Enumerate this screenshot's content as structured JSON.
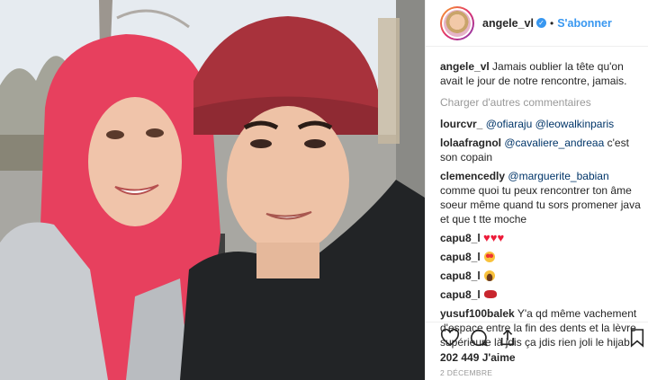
{
  "post": {
    "username": "angele_vl",
    "follow_label": "S'abonner",
    "separator": "•",
    "caption": "Jamais oublier la tête qu'on avait le jour de notre rencontre, jamais.",
    "load_more": "Charger d'autres commentaires",
    "likes": "202 449 J'aime",
    "date": "2 DÉCEMBRE"
  },
  "comments": [
    {
      "user": "lourcvr_",
      "mentions": [
        "@ofiaraju",
        "@leowalkinparis"
      ],
      "text": ""
    },
    {
      "user": "lolaafragnol",
      "mentions": [
        "@cavaliere_andreaa"
      ],
      "text": "c'est son copain"
    },
    {
      "user": "clemencedly",
      "mentions": [
        "@marguerite_babian"
      ],
      "text": "comme quoi tu peux rencontrer ton âme soeur même quand tu sors promener java et que t tte moche"
    },
    {
      "user": "capu8_l",
      "emoji": "hearts"
    },
    {
      "user": "capu8_l",
      "emoji": "heart-eyes"
    },
    {
      "user": "capu8_l",
      "emoji": "grin"
    },
    {
      "user": "capu8_l",
      "emoji": "kiss"
    },
    {
      "user": "yusuf100balek",
      "text": "Y'a qd même vachement d'espace entre la fin des dents et la lèvre supérieure là jdis ça jdis rien joli le hijab"
    }
  ],
  "icons": {
    "like": "heart-outline-icon",
    "comment": "comment-icon",
    "share": "share-icon",
    "save": "bookmark-icon",
    "verified": "verified-badge-icon"
  },
  "colors": {
    "accent": "#3897f0",
    "mention": "#003569",
    "muted": "#999999",
    "heart": "#ed1c3a"
  }
}
